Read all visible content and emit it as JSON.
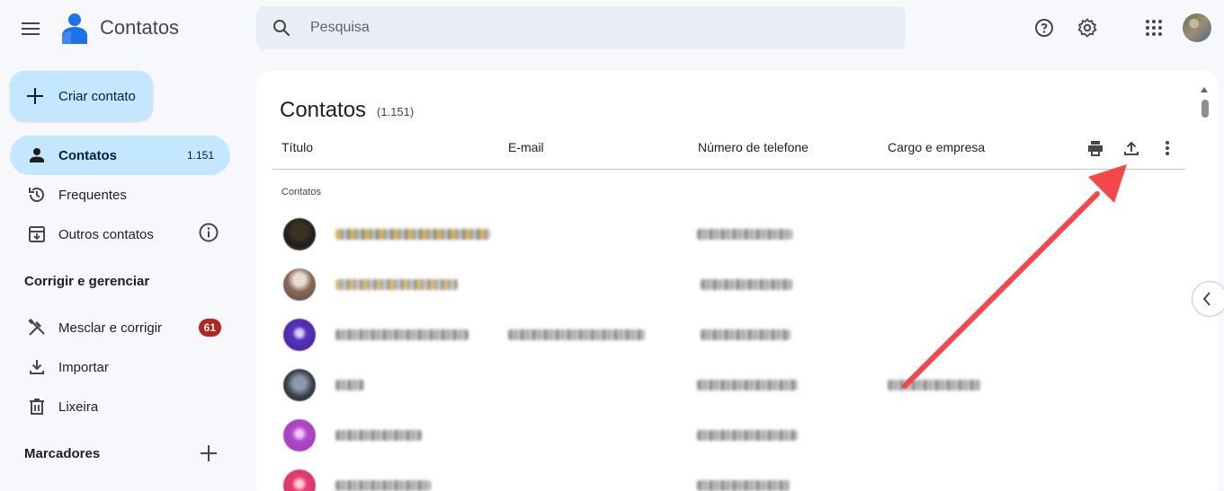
{
  "app": {
    "title": "Contatos"
  },
  "search": {
    "placeholder": "Pesquisa"
  },
  "topbar_icons": [
    "menu-icon",
    "help-icon",
    "settings-icon",
    "apps-grid-icon",
    "avatar"
  ],
  "sidebar": {
    "create_label": "Criar contato",
    "items": [
      {
        "label": "Contatos",
        "count": "1.151",
        "active": true,
        "icon": "person-icon"
      },
      {
        "label": "Frequentes",
        "icon": "history-icon"
      },
      {
        "label": "Outros contatos",
        "icon": "archive-icon"
      }
    ],
    "fix_section": "Corrigir e gerenciar",
    "fix_items": [
      {
        "label": "Mesclar e corrigir",
        "badge": "61",
        "icon": "merge-tools-icon"
      },
      {
        "label": "Importar",
        "icon": "download-icon"
      },
      {
        "label": "Lixeira",
        "icon": "trash-icon"
      }
    ],
    "labels_section": "Marcadores"
  },
  "main": {
    "title": "Contatos",
    "count": "(1.151)",
    "columns": [
      "Título",
      "E-mail",
      "Número de telefone",
      "Cargo e empresa"
    ],
    "group_label": "Contatos",
    "toolbar_icons": [
      "print-icon",
      "export-icon",
      "more-vert-icon"
    ],
    "rows_note": "contact names, emails and phones are pixelated/obscured"
  },
  "colors": {
    "accent": "#c2e7ff",
    "badge": "#b3261e",
    "annotation_arrow": "#f24848"
  }
}
